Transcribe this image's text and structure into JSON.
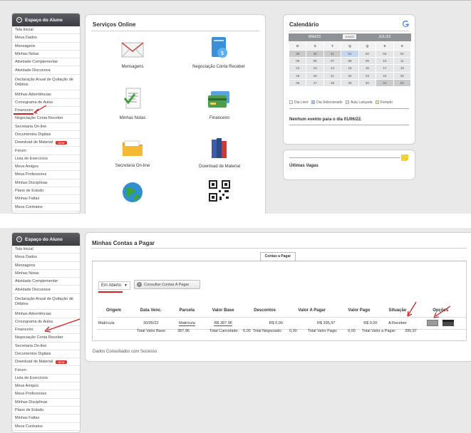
{
  "sidebar": {
    "title": "Espaço do Aluno",
    "items": [
      {
        "label": "Tela Inicial"
      },
      {
        "label": "Meus Dados"
      },
      {
        "label": "Mensagens"
      },
      {
        "label": "Minhas Notas"
      },
      {
        "label": "Atividade Complementar"
      },
      {
        "label": "Atividade Discursiva"
      },
      {
        "label": "Declaração Anual de Quitação de Débitos"
      },
      {
        "label": "Minhas Advertências"
      },
      {
        "label": "Cronograma de Aulas"
      },
      {
        "label": "Financeiro"
      },
      {
        "label": "Negociação Conta Receber"
      },
      {
        "label": "Secretaria On-line"
      },
      {
        "label": "Documentos Digitais"
      },
      {
        "label": "Download de Material",
        "badge": "NEW"
      },
      {
        "label": "Fórum"
      },
      {
        "label": "Lista de Exercícios"
      },
      {
        "label": "Meus Amigos"
      },
      {
        "label": "Meus Professores"
      },
      {
        "label": "Minhas Disciplinas"
      },
      {
        "label": "Plano de Estudo"
      },
      {
        "label": "Minhas Faltas"
      },
      {
        "label": "Meus Contratos"
      }
    ]
  },
  "servicos": {
    "title": "Serviços Online",
    "items": [
      {
        "label": "Mensagens",
        "icon": "mail-icon"
      },
      {
        "label": "Negociação Conta Receber",
        "icon": "money-document-icon"
      },
      {
        "label": "Minhas Notas",
        "icon": "grades-document-icon"
      },
      {
        "label": "Financeiro",
        "icon": "credit-card-icon"
      },
      {
        "label": "Secretaria On-line",
        "icon": "folder-icon"
      },
      {
        "label": "Download de Material",
        "icon": "books-icon"
      },
      {
        "label": "",
        "icon": "globe-icon"
      },
      {
        "label": "",
        "icon": "qr-code-icon"
      }
    ]
  },
  "calendario": {
    "title": "Calendário",
    "prev_month": "MAI/22",
    "current_month": "JUN/22",
    "next_month": "JUL/22",
    "weekdays": [
      "D",
      "S",
      "T",
      "Q",
      "Q",
      "S",
      "S"
    ],
    "weeks": [
      [
        "29",
        "30",
        "31",
        "01",
        "02",
        "03",
        "04"
      ],
      [
        "05",
        "06",
        "07",
        "08",
        "09",
        "10",
        "11"
      ],
      [
        "12",
        "13",
        "14",
        "15",
        "16",
        "17",
        "18"
      ],
      [
        "19",
        "20",
        "21",
        "22",
        "23",
        "24",
        "25"
      ],
      [
        "26",
        "27",
        "28",
        "29",
        "30",
        "01",
        "02"
      ]
    ],
    "legend": [
      "Dia Livre",
      "Dia Selecionado",
      "Aula Lançada",
      "Feriado"
    ],
    "event_text": "Nenhum evento para o dia 01/06/22."
  },
  "ultimas_vagas": {
    "title": "Últimas Vagas"
  },
  "contas": {
    "title": "Minhas Contas a Pagar",
    "tab": "Contas a Pagar",
    "filter_value": "Em Aberto",
    "consult_button": "Consultar Contas A Pagar",
    "columns": [
      "Origem",
      "Data Venc.",
      "Parcela",
      "Valor Base",
      "Descontos",
      "Valor A Pagar",
      "Valor Pago",
      "Situação",
      "Opções"
    ],
    "rows": [
      {
        "origem": "Matrícula",
        "data_venc": "30/05/22",
        "parcela": "Matrícula",
        "valor_base": "R$ 387,96",
        "descontos": "R$ 0,00",
        "valor_a_pagar": "R$ 395,97",
        "valor_pago": "R$ 0,00",
        "situacao": "A Receber"
      }
    ],
    "totals": {
      "base_label": "Total Valor Base:",
      "base_value": "387,96",
      "cancelado_label": "Total Cancelado:",
      "cancelado_value": "0,00",
      "negociado_label": "Total Negociado:",
      "negociado_value": "0,00",
      "pago_label": "Total Valor Pago:",
      "pago_value": "0,00",
      "a_pagar_label": "Total Valor a Pagar:",
      "a_pagar_value": "395,97"
    },
    "status": "Dados Consultados com Sucesso"
  },
  "colors": {
    "accent_red": "#d42020",
    "calendar_header": "#8f9296",
    "calendar_cell": "#e4e5e7",
    "calendar_selected": "#c5d7ee"
  }
}
